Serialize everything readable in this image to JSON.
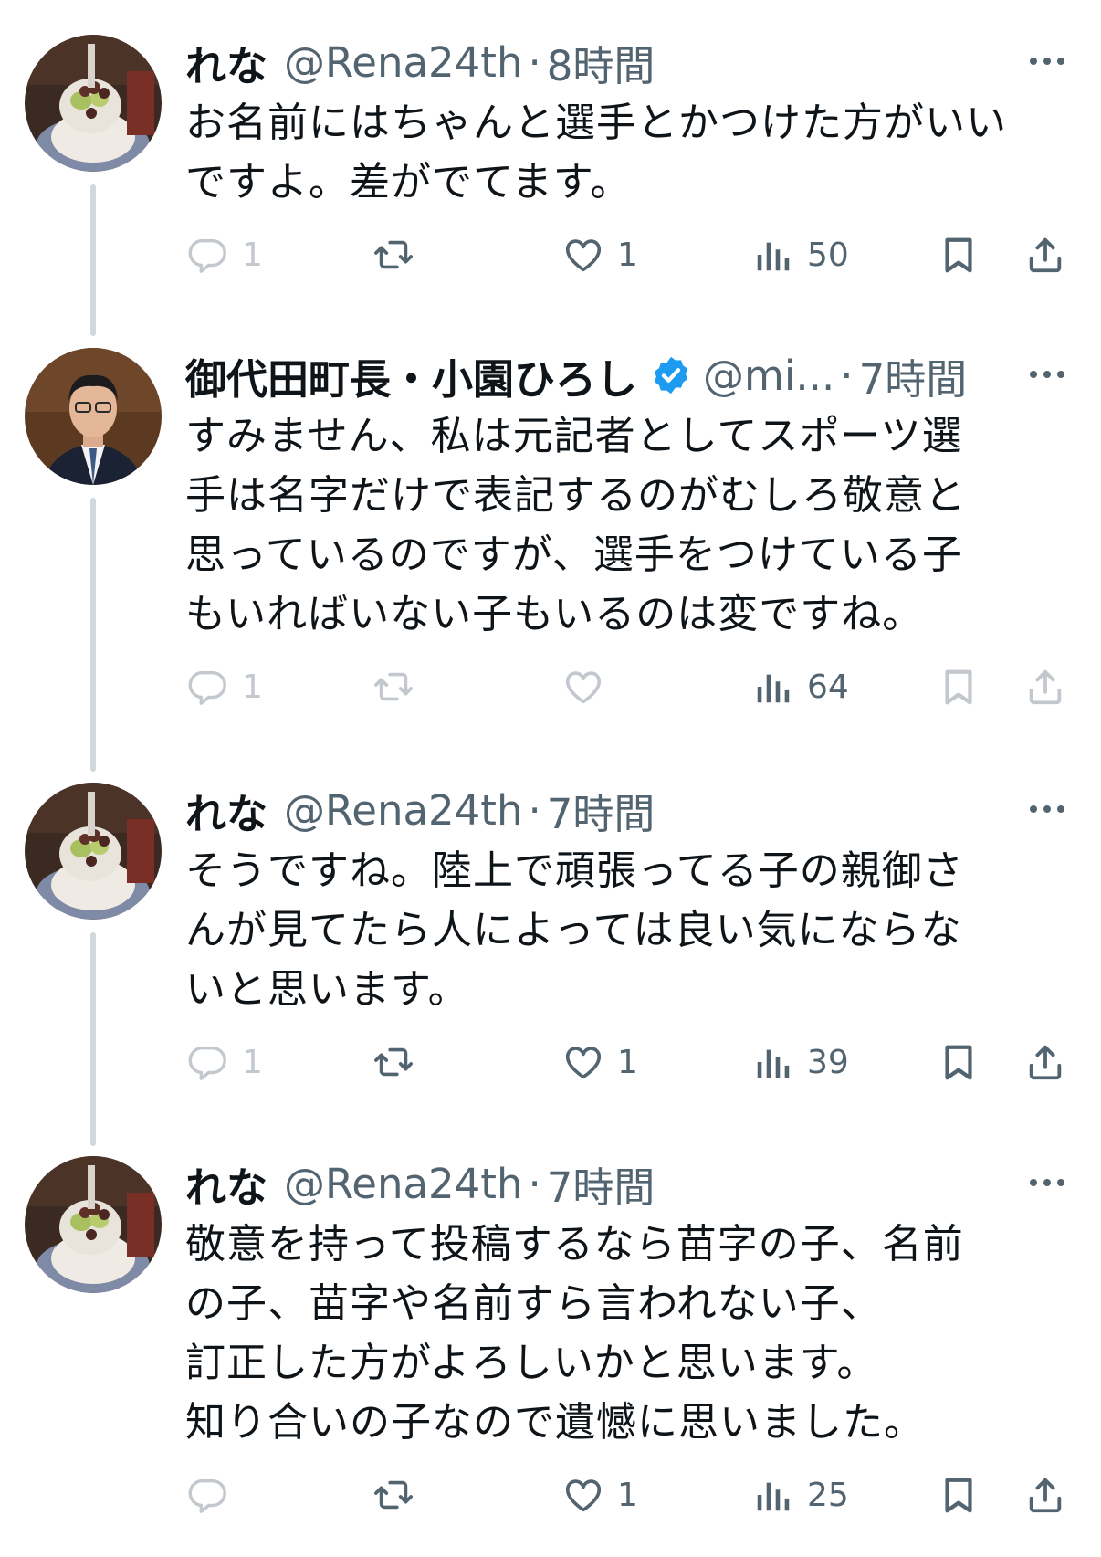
{
  "tweets": [
    {
      "name": "れな",
      "handle": "@Rena24th",
      "dot": "·",
      "time": "8時間",
      "verified": false,
      "text": "お名前にはちゃんと選手とかつけた方がいい\nですよ。差がでてます。",
      "replies": "1",
      "retweets": "",
      "likes": "1",
      "views": "50",
      "dimmed": false
    },
    {
      "name": "御代田町長・小園ひろし",
      "handle": "@mi...",
      "dot": "·",
      "time": "7時間",
      "verified": true,
      "text": "すみません、私は元記者としてスポーツ選\n手は名字だけで表記するのがむしろ敬意と\n思っているのですが、選手をつけている子\nもいればいない子もいるのは変ですね。",
      "replies": "1",
      "retweets": "",
      "likes": "",
      "views": "64",
      "dimmed": true
    },
    {
      "name": "れな",
      "handle": "@Rena24th",
      "dot": "·",
      "time": "7時間",
      "verified": false,
      "text": "そうですね。陸上で頑張ってる子の親御さ\nんが見てたら人によっては良い気にならな\nいと思います。",
      "replies": "1",
      "retweets": "",
      "likes": "1",
      "views": "39",
      "dimmed": false
    },
    {
      "name": "れな",
      "handle": "@Rena24th",
      "dot": "·",
      "time": "7時間",
      "verified": false,
      "text": "敬意を持って投稿するなら苗字の子、名前\nの子、苗字や名前すら言われない子、\n訂正した方がよろしいかと思います。\n知り合いの子なので遺憾に思いました。",
      "replies": "",
      "retweets": "",
      "likes": "1",
      "views": "25",
      "dimmed": false
    }
  ],
  "colors": {
    "text": "#0f1419",
    "secondary": "#536471",
    "thread_line": "#cfd9de",
    "verified": "#1d9bf0"
  },
  "icons": [
    "reply-icon",
    "retweet-icon",
    "like-icon",
    "views-icon",
    "bookmark-icon",
    "share-icon",
    "more-icon",
    "verified-badge-icon"
  ]
}
